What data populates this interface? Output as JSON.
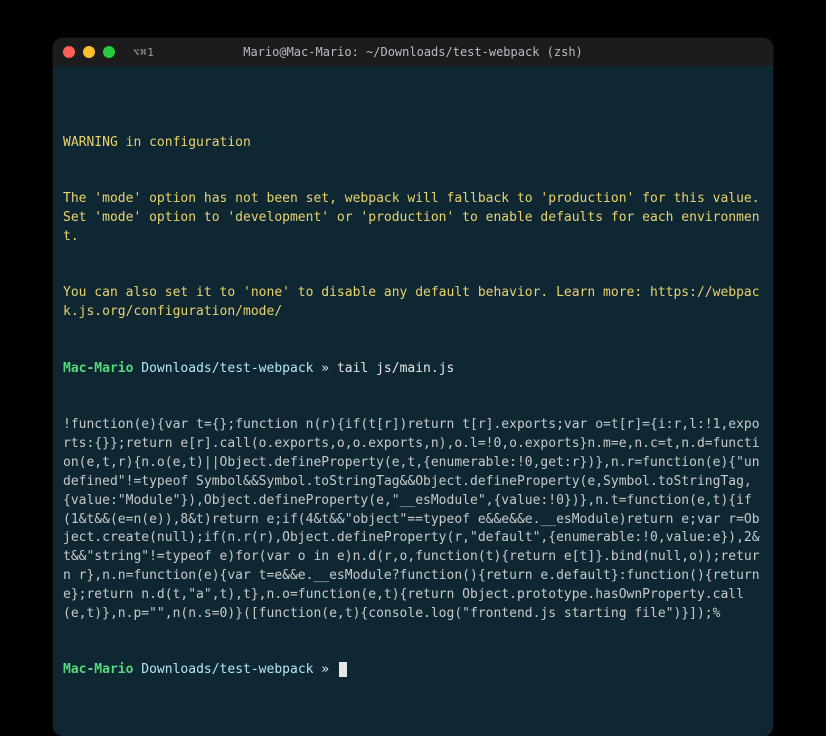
{
  "titlebar": {
    "tab_indicator": "⌥⌘1",
    "title": "Mario@Mac-Mario: ~/Downloads/test-webpack (zsh)"
  },
  "warning": {
    "l1": "WARNING in configuration",
    "l2": "The 'mode' option has not been set, webpack will fallback to 'production' for this value. Set 'mode' option to 'development' or 'production' to enable defaults for each environment.",
    "l3": "You can also set it to 'none' to disable any default behavior. Learn more: https://webpack.js.org/configuration/mode/"
  },
  "prompt1": {
    "host": "Mac-Mario",
    "path": "Downloads/test-webpack",
    "arrow": "»",
    "cmd": "tail js/main.js"
  },
  "output": "!function(e){var t={};function n(r){if(t[r])return t[r].exports;var o=t[r]={i:r,l:!1,exports:{}};return e[r].call(o.exports,o,o.exports,n),o.l=!0,o.exports}n.m=e,n.c=t,n.d=function(e,t,r){n.o(e,t)||Object.defineProperty(e,t,{enumerable:!0,get:r})},n.r=function(e){\"undefined\"!=typeof Symbol&&Symbol.toStringTag&&Object.defineProperty(e,Symbol.toStringTag,{value:\"Module\"}),Object.defineProperty(e,\"__esModule\",{value:!0})},n.t=function(e,t){if(1&t&&(e=n(e)),8&t)return e;if(4&t&&\"object\"==typeof e&&e&&e.__esModule)return e;var r=Object.create(null);if(n.r(r),Object.defineProperty(r,\"default\",{enumerable:!0,value:e}),2&t&&\"string\"!=typeof e)for(var o in e)n.d(r,o,function(t){return e[t]}.bind(null,o));return r},n.n=function(e){var t=e&&e.__esModule?function(){return e.default}:function(){return e};return n.d(t,\"a\",t),t},n.o=function(e,t){return Object.prototype.hasOwnProperty.call(e,t)},n.p=\"\",n(n.s=0)}([function(e,t){console.log(\"frontend.js starting file\")}]);%",
  "prompt2": {
    "host": "Mac-Mario",
    "path": "Downloads/test-webpack",
    "arrow": "»"
  }
}
